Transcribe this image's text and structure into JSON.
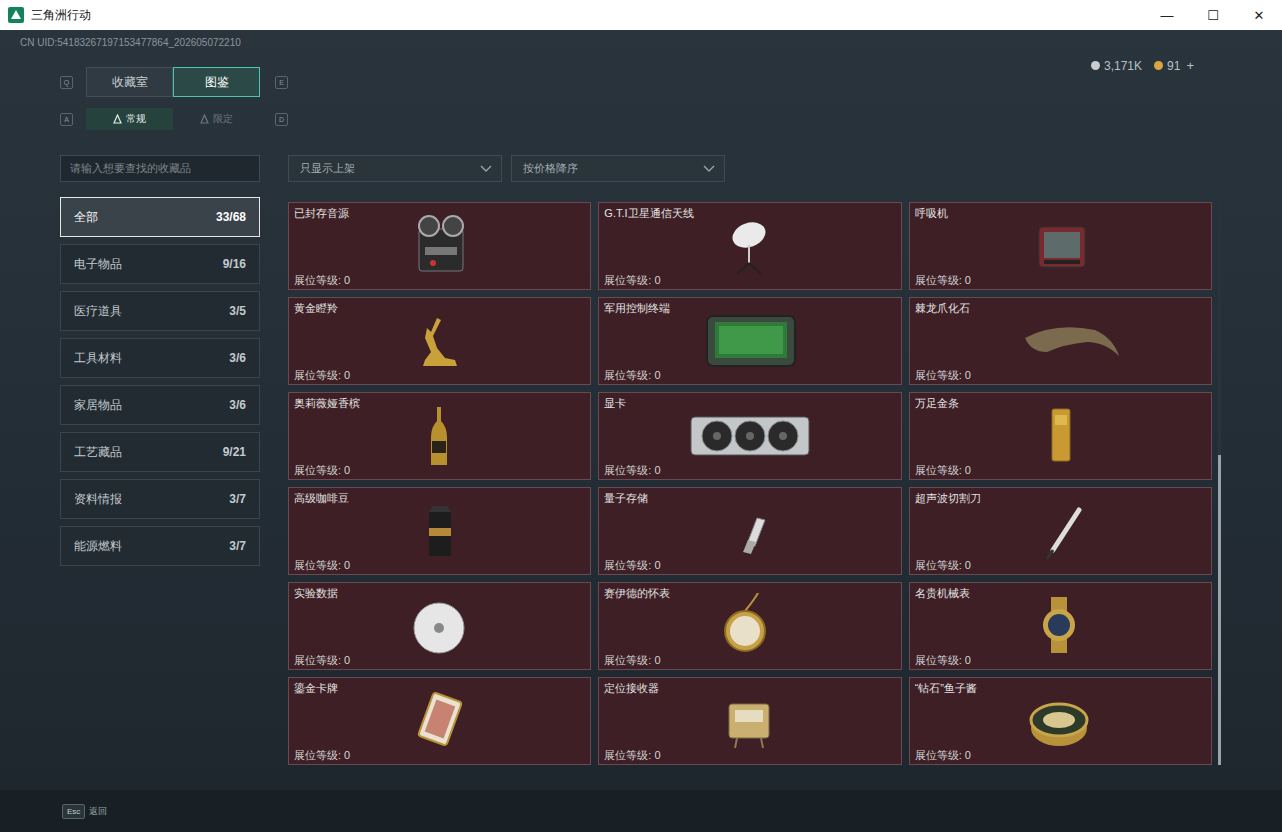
{
  "window": {
    "title": "三角洲行动",
    "controls": [
      "—",
      "☐",
      "✕"
    ]
  },
  "uid": "CN UID:54183267197153477864_202605072210",
  "currency": [
    {
      "value": "3,171K",
      "color": "#c9cdd1"
    },
    {
      "value": "91",
      "color": "#d9a441"
    }
  ],
  "currency_add": "+",
  "tabs": {
    "keys": [
      "Q",
      "E"
    ],
    "items": [
      {
        "label": "收藏室",
        "selected": false
      },
      {
        "label": "图鉴",
        "selected": true
      }
    ]
  },
  "subtabs": {
    "keys": [
      "A",
      "D"
    ],
    "items": [
      {
        "label": "常规",
        "selected": true
      },
      {
        "label": "限定",
        "selected": false
      }
    ]
  },
  "search": {
    "placeholder": "请输入想要查找的收藏品"
  },
  "filters": [
    {
      "label": "只显示上架"
    },
    {
      "label": "按价格降序"
    }
  ],
  "categories": [
    {
      "label": "全部",
      "count": "33/68",
      "selected": true
    },
    {
      "label": "电子物品",
      "count": "9/16",
      "selected": false
    },
    {
      "label": "医疗道具",
      "count": "3/5",
      "selected": false
    },
    {
      "label": "工具材料",
      "count": "3/6",
      "selected": false
    },
    {
      "label": "家居物品",
      "count": "3/6",
      "selected": false
    },
    {
      "label": "工艺藏品",
      "count": "9/21",
      "selected": false
    },
    {
      "label": "资料情报",
      "count": "3/7",
      "selected": false
    },
    {
      "label": "能源燃料",
      "count": "3/7",
      "selected": false
    }
  ],
  "items": [
    {
      "name": "已封存音源",
      "level_label": "展位等级: 0"
    },
    {
      "name": "G.T.I卫星通信天线",
      "level_label": "展位等级: 0"
    },
    {
      "name": "呼吸机",
      "level_label": "展位等级: 0"
    },
    {
      "name": "黄金瞪羚",
      "level_label": "展位等级: 0"
    },
    {
      "name": "军用控制终端",
      "level_label": "展位等级: 0"
    },
    {
      "name": "棘龙爪化石",
      "level_label": "展位等级: 0"
    },
    {
      "name": "奥莉薇娅香槟",
      "level_label": "展位等级: 0"
    },
    {
      "name": "显卡",
      "level_label": "展位等级: 0"
    },
    {
      "name": "万足金条",
      "level_label": "展位等级: 0"
    },
    {
      "name": "高级咖啡豆",
      "level_label": "展位等级: 0"
    },
    {
      "name": "量子存储",
      "level_label": "展位等级: 0"
    },
    {
      "name": "超声波切割刀",
      "level_label": "展位等级: 0"
    },
    {
      "name": "实验数据",
      "level_label": "展位等级: 0"
    },
    {
      "name": "赛伊德的怀表",
      "level_label": "展位等级: 0"
    },
    {
      "name": "名贵机械表",
      "level_label": "展位等级: 0"
    },
    {
      "name": "鎏金卡牌",
      "level_label": "展位等级: 0"
    },
    {
      "name": "定位接收器",
      "level_label": "展位等级: 0"
    },
    {
      "name": "“钻石”鱼子酱",
      "level_label": "展位等级: 0"
    }
  ],
  "scrollbar": {
    "level": 0.55,
    "offset": 0.45
  },
  "footer": {
    "key": "Esc",
    "label": "返回"
  }
}
